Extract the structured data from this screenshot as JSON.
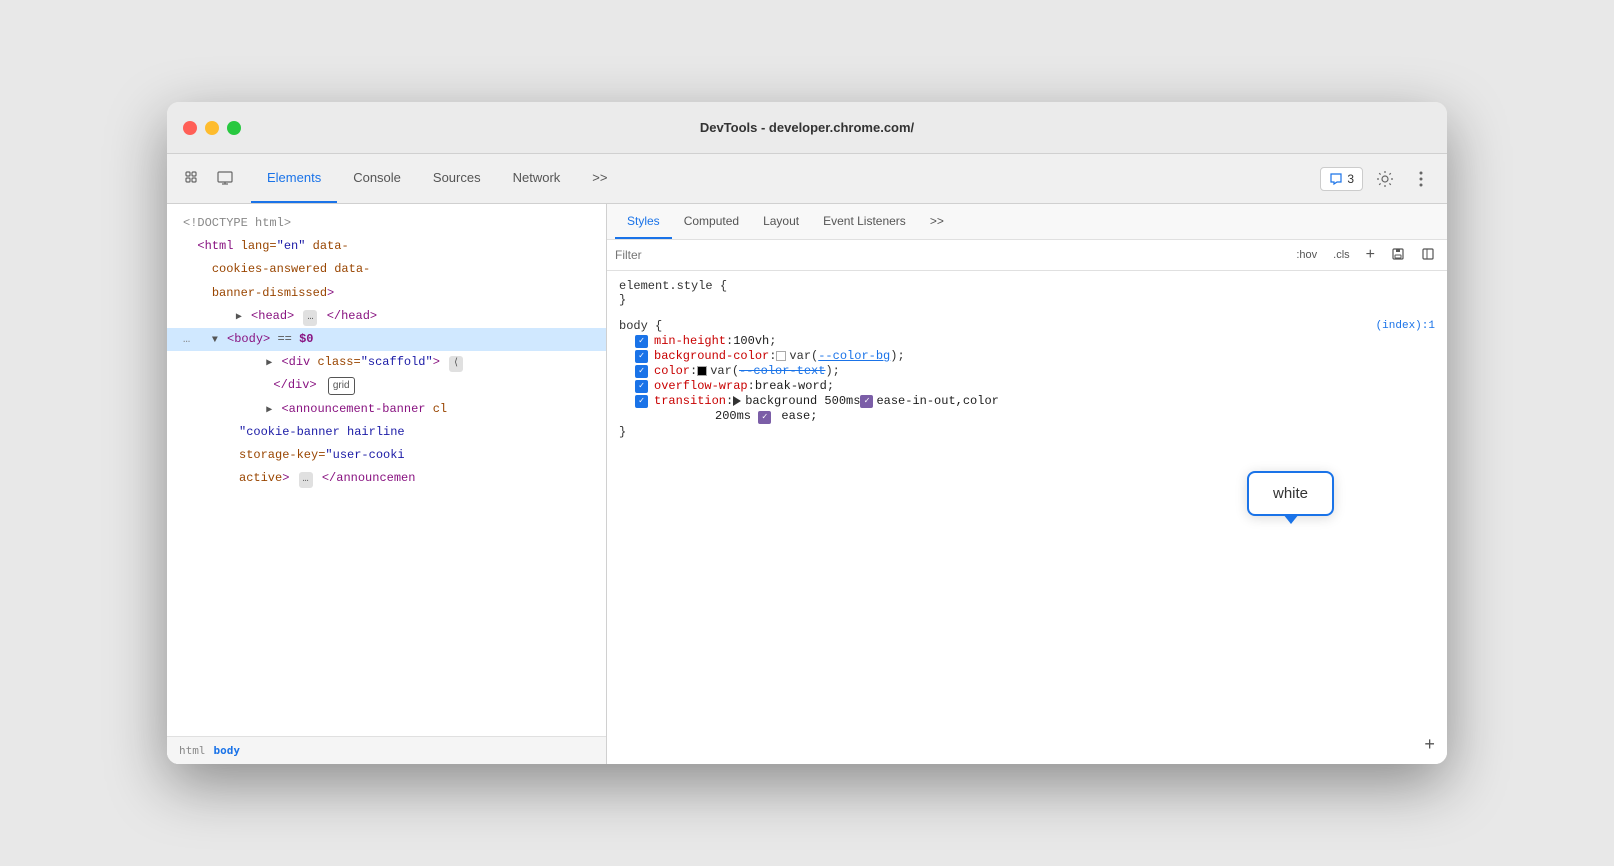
{
  "window": {
    "title": "DevTools - developer.chrome.com/"
  },
  "toolbar": {
    "tabs": [
      "Elements",
      "Console",
      "Sources",
      "Network"
    ],
    "more_label": ">>",
    "badge_count": "3",
    "active_tab": "Elements"
  },
  "styles_tabs": {
    "tabs": [
      "Styles",
      "Computed",
      "Layout",
      "Event Listeners"
    ],
    "more_label": ">>",
    "active_tab": "Styles"
  },
  "filter": {
    "placeholder": "Filter",
    "hov_label": ":hov",
    "cls_label": ".cls"
  },
  "dom": {
    "doctype": "<!DOCTYPE html>",
    "line2a": "<html lang=\"en\" data-",
    "line2b": "cookies-answered data-",
    "line2c": "banner-dismissed>",
    "head": "<head>",
    "head_close": "</head>",
    "body_open": "<body>",
    "body_eq": "== $0",
    "body_dots": "...",
    "div_scaffold": "<div class=\"scaffold\">",
    "div_scaffold_close": "</div>",
    "grid_badge": "grid",
    "announcement": "<announcement-banner cl",
    "cookie_banner": "\"cookie-banner hairline",
    "storage_key": "storage-key=\"user-cooki",
    "active": "active>",
    "announcement_close": "</announcemen",
    "breadcrumb_html": "html",
    "breadcrumb_body": "body"
  },
  "css": {
    "element_style_selector": "element.style {",
    "element_style_close": "}",
    "body_selector": "body {",
    "body_close": "}",
    "origin": "(index):1",
    "properties": [
      {
        "prop": "min-height",
        "value": "100vh",
        "checked": true,
        "color": null
      },
      {
        "prop": "background-color",
        "value": "var(--color-bg)",
        "checked": true,
        "color": "white",
        "has_swatch": true,
        "swatch_color": "white",
        "var_link": "--color-bg"
      },
      {
        "prop": "color",
        "value": "var(--color-text)",
        "checked": true,
        "color": "black",
        "has_swatch": true,
        "swatch_color": "black",
        "var_link": "--color-text"
      },
      {
        "prop": "overflow-wrap",
        "value": "break-word",
        "checked": true,
        "color": null
      },
      {
        "prop": "transition",
        "value": "background 500ms ease-in-out,color 200ms ease",
        "checked": true,
        "color": null,
        "has_triangle": true
      }
    ]
  },
  "tooltip": {
    "text": "white"
  },
  "icons": {
    "cursor": "⬚",
    "inspect": "⧉",
    "more": "⋮",
    "plus": "+",
    "save": "💾",
    "layout": "⬜",
    "settings": "⚙"
  }
}
